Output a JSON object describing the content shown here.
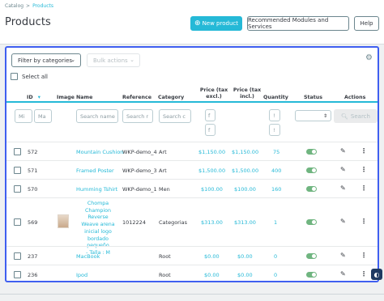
{
  "breadcrumb": {
    "parent": "Catalog",
    "separator": ">",
    "current": "Products"
  },
  "page_title": "Products",
  "toolbar": {
    "new_product": "New product",
    "recommended_modules": "Recommended Modules and Services",
    "help": "Help"
  },
  "filters": {
    "filter_by": "Filter by categories",
    "bulk_actions": "Bulk actions",
    "select_all": "Select all"
  },
  "columns": {
    "id": "ID",
    "image": "Image",
    "name": "Name",
    "reference": "Reference",
    "category": "Category",
    "price_excl": "Price (tax excl.)",
    "price_incl": "Price (tax incl.)",
    "quantity": "Quantity",
    "status": "Status",
    "actions": "Actions"
  },
  "filter_inputs": {
    "id_min": "Mi",
    "id_max": "Ma",
    "name_placeholder": "Search name",
    "reference_placeholder": "Search r",
    "category_placeholder": "Search c",
    "search_button": "Search"
  },
  "rows": [
    {
      "id": "572",
      "name": "Mountain Cushion",
      "reference": "WKP-demo_4",
      "category": "Art",
      "price_excl": "$1,150.00",
      "price_incl": "$1,150.00",
      "quantity": "75"
    },
    {
      "id": "571",
      "name": "Framed Poster",
      "reference": "WKP-demo_3",
      "category": "Art",
      "price_excl": "$1,500.00",
      "price_incl": "$1,500.00",
      "quantity": "400"
    },
    {
      "id": "570",
      "name": "Humming Tshirt",
      "reference": "WKP-demo_1",
      "category": "Men",
      "price_excl": "$100.00",
      "price_incl": "$100.00",
      "quantity": "160"
    },
    {
      "id": "569",
      "name_lines": [
        "Chompa",
        "Champion Reverse",
        "Weave arena",
        "inicial logo",
        "bordado pequeño",
        "- Talla : M"
      ],
      "reference": "1012224",
      "category": "Categorias",
      "price_excl": "$313.00",
      "price_incl": "$313.00",
      "quantity": "1"
    },
    {
      "id": "237",
      "name": "MacBook",
      "reference": "",
      "category": "Root",
      "price_excl": "$0.00",
      "price_incl": "$0.00",
      "quantity": "0"
    },
    {
      "id": "236",
      "name": "Ipod",
      "reference": "",
      "category": "Root",
      "price_excl": "$0.00",
      "price_incl": "$0.00",
      "quantity": "0"
    }
  ],
  "colors": {
    "accent": "#25b9d7",
    "focus_border": "#3f5ff0",
    "toggle_on": "#70b580"
  }
}
